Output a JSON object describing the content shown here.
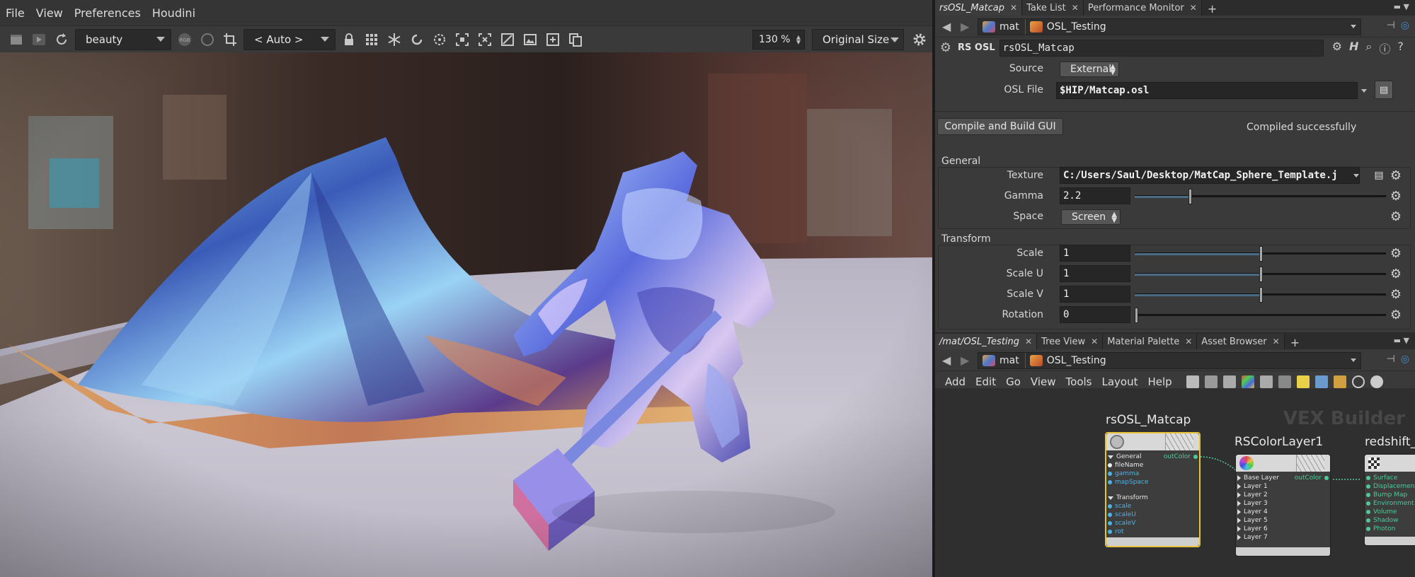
{
  "menubar": {
    "items": [
      "File",
      "View",
      "Preferences",
      "Houdini"
    ]
  },
  "viewer_toolbar": {
    "aov": "beauty",
    "rgb_icon": "rgb-icon",
    "camera": "< Auto >",
    "zoom": "130 %",
    "size_mode": "Original Size"
  },
  "params_pane": {
    "tabs": [
      {
        "label": "rsOSL_Matcap",
        "active": true
      },
      {
        "label": "Take List"
      },
      {
        "label": "Performance Monitor"
      }
    ],
    "path": {
      "context": "mat",
      "network": "OSL_Testing"
    },
    "node_type": "RS OSL",
    "node_name": "rsOSL_Matcap",
    "source_label": "Source",
    "source_value": "External",
    "osl_file_label": "OSL File",
    "osl_file_value": "$HIP/Matcap.osl",
    "compile_button": "Compile and Build GUI",
    "compile_status": "Compiled successfully",
    "general": {
      "title": "General",
      "texture_label": "Texture",
      "texture_value": "C:/Users/Saul/Desktop/MatCap_Sphere_Template.j",
      "gamma_label": "Gamma",
      "gamma_value": "2.2",
      "space_label": "Space",
      "space_value": "Screen"
    },
    "transform": {
      "title": "Transform",
      "scale_label": "Scale",
      "scale_value": "1",
      "scaleu_label": "Scale U",
      "scaleu_value": "1",
      "scalev_label": "Scale V",
      "scalev_value": "1",
      "rotation_label": "Rotation",
      "rotation_value": "0"
    },
    "sliders": {
      "gamma": 0.22,
      "scale": 0.5,
      "scaleu": 0.5,
      "scalev": 0.5,
      "rotation": 0.0
    }
  },
  "network_pane": {
    "tabs": [
      {
        "label": "/mat/OSL_Testing",
        "active": true
      },
      {
        "label": "Tree View"
      },
      {
        "label": "Material Palette"
      },
      {
        "label": "Asset Browser"
      }
    ],
    "path": {
      "context": "mat",
      "network": "OSL_Testing"
    },
    "menus": [
      "Add",
      "Edit",
      "Go",
      "View",
      "Tools",
      "Layout",
      "Help"
    ],
    "watermark": "VEX Builder",
    "nodes": {
      "matcap": {
        "title": "rsOSL_Matcap",
        "output": "outColor",
        "group1": "General",
        "inputs1": [
          "fileName",
          "gamma",
          "mapSpace"
        ],
        "group2": "Transform",
        "inputs2": [
          "scale",
          "scaleU",
          "scaleV",
          "rot"
        ]
      },
      "colorlayer": {
        "title": "RSColorLayer1",
        "output": "outColor",
        "inputs": [
          "Base Layer",
          "Layer 1",
          "Layer 2",
          "Layer 3",
          "Layer 4",
          "Layer 5",
          "Layer 6",
          "Layer 7"
        ]
      },
      "redshift": {
        "title": "redshift_",
        "inputs": [
          "Surface",
          "Displacement",
          "Bump Map",
          "Environment",
          "Volume",
          "Shadow",
          "Photon"
        ]
      }
    }
  },
  "colors": {
    "accent": "#4b6a86",
    "selected_node": "#e8c23a",
    "port_cyan": "#4fb2e6",
    "port_green": "#4fc99a"
  }
}
